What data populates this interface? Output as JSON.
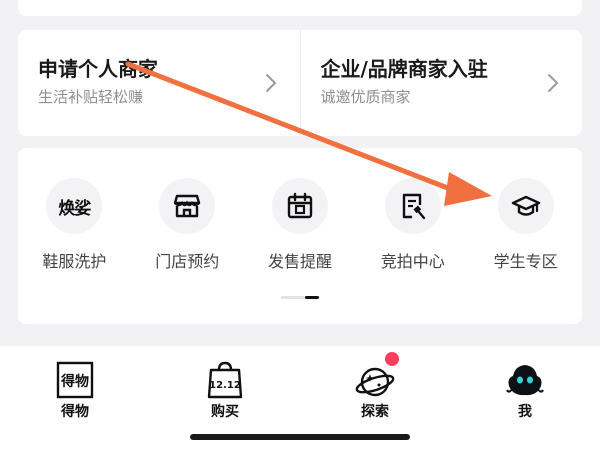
{
  "merchant": {
    "personal": {
      "title": "申请个人商家",
      "subtitle": "生活补贴轻松赚"
    },
    "enterprise": {
      "title": "企业/品牌商家入驻",
      "subtitle": "诚邀优质商家"
    }
  },
  "services": [
    {
      "label": "鞋服洗护",
      "icon": "huanxin-text-icon",
      "icon_text": "焕娑"
    },
    {
      "label": "门店预约",
      "icon": "storefront-icon"
    },
    {
      "label": "发售提醒",
      "icon": "calendar-icon"
    },
    {
      "label": "竞拍中心",
      "icon": "auction-icon"
    },
    {
      "label": "学生专区",
      "icon": "graduation-cap-icon"
    }
  ],
  "pager": {
    "pages": 2,
    "current": 2
  },
  "tabs": [
    {
      "label": "得物",
      "icon": "dewu-logo-icon",
      "icon_text": "得物"
    },
    {
      "label": "购买",
      "icon": "shopping-bag-icon",
      "icon_text": "12.12"
    },
    {
      "label": "探索",
      "icon": "planet-icon",
      "badge": true
    },
    {
      "label": "我",
      "icon": "avatar-icon"
    }
  ],
  "colors": {
    "arrow": "#f07040",
    "badge": "#ff3d5c",
    "card_bg": "#ffffff",
    "page_bg": "#f2f2f5"
  }
}
